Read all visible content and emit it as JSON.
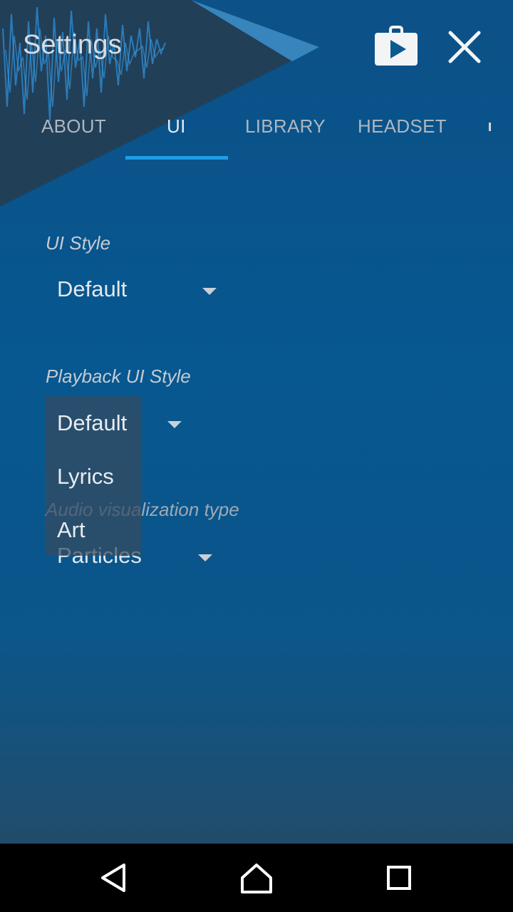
{
  "header": {
    "title": "Settings",
    "store_icon": "play-store-bag-icon",
    "close_icon": "close-icon"
  },
  "tabs": [
    {
      "label": "ABOUT",
      "active": false
    },
    {
      "label": "UI",
      "active": true
    },
    {
      "label": "LIBRARY",
      "active": false
    },
    {
      "label": "HEADSET",
      "active": false
    }
  ],
  "settings": {
    "ui_style": {
      "label": "UI Style",
      "value": "Default"
    },
    "playback_ui_style": {
      "label": "Playback UI Style",
      "value": "Default",
      "options": [
        "Default",
        "Lyrics",
        "Art"
      ]
    },
    "audio_visualization": {
      "label": "Audio visualization type",
      "value": "Particles"
    }
  },
  "navbar": {
    "back_icon": "back-icon",
    "home_icon": "home-icon",
    "recents_icon": "recents-icon"
  },
  "colors": {
    "accent": "#1e9ee8",
    "background": "#075790",
    "navbar": "#000000"
  }
}
